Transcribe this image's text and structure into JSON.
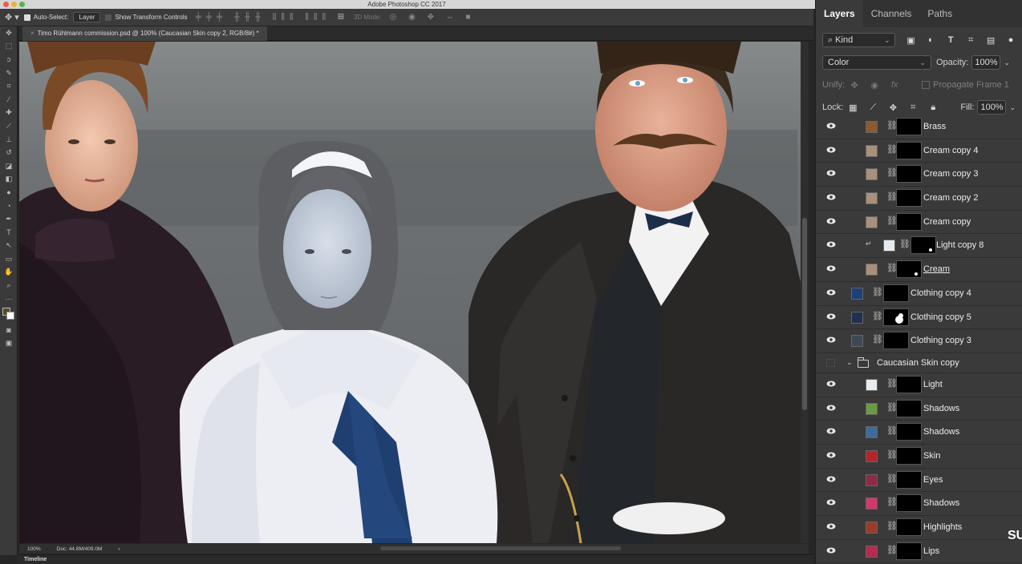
{
  "window": {
    "title": "Adobe Photoshop CC 2017"
  },
  "options_bar": {
    "auto_select_label": "Auto-Select:",
    "auto_select_value": "Layer",
    "show_transform_label": "Show Transform Controls",
    "mode_3d_label": "3D Mode:"
  },
  "document": {
    "tab_title": "Timo Rühlmann commission.psd @ 100% (Caucasian Skin copy 2, RGB/8#) *"
  },
  "status": {
    "zoom": "100%",
    "doc_size": "Doc: 44.8M/409.0M"
  },
  "timeline": {
    "label": "Timeline"
  },
  "panel": {
    "tabs": [
      "Layers",
      "Channels",
      "Paths"
    ],
    "filter_value": "Kind",
    "blend_mode": "Color",
    "opacity_label": "Opacity:",
    "opacity_value": "100%",
    "unify_label": "Unify:",
    "propagate_label": "Propagate Frame 1",
    "lock_label": "Lock:",
    "fill_label": "Fill:",
    "fill_value": "100%"
  },
  "layers": [
    {
      "name": "Brass",
      "color": "#8a5a32",
      "indent": 1
    },
    {
      "name": "Cream copy 4",
      "color": "#a9907a",
      "indent": 1
    },
    {
      "name": "Cream copy 3",
      "color": "#a9907a",
      "indent": 1
    },
    {
      "name": "Cream copy 2",
      "color": "#a9907a",
      "indent": 1
    },
    {
      "name": "Cream copy",
      "color": "#a9907a",
      "indent": 1
    },
    {
      "name": "Light copy 8",
      "color": "#e6ebf0",
      "indent": 2,
      "clipped": true
    },
    {
      "name": "Cream",
      "color": "#a9907a",
      "indent": 1,
      "underlined": true
    },
    {
      "name": "Clothing copy 4",
      "color": "#1e3f78",
      "indent": 0
    },
    {
      "name": "Clothing copy 5",
      "color": "#22304f",
      "indent": 0
    },
    {
      "name": "Clothing copy 3",
      "color": "#3d4a56",
      "indent": 0
    },
    {
      "group": true,
      "name": "Caucasian Skin copy"
    },
    {
      "name": "Light",
      "color": "#e8ecef",
      "indent": 1
    },
    {
      "name": "Shadows",
      "color": "#6c9a44",
      "indent": 1
    },
    {
      "name": "Shadows",
      "color": "#3f6a9c",
      "indent": 1
    },
    {
      "name": "Skin",
      "color": "#b5242c",
      "indent": 1
    },
    {
      "name": "Eyes",
      "color": "#8e2a45",
      "indent": 1
    },
    {
      "name": "Shadows",
      "color": "#d2386c",
      "indent": 1
    },
    {
      "name": "Highlights",
      "color": "#9a3b2c",
      "indent": 1
    },
    {
      "name": "Lips",
      "color": "#b52a4d",
      "indent": 1
    }
  ],
  "watermark": "SU"
}
